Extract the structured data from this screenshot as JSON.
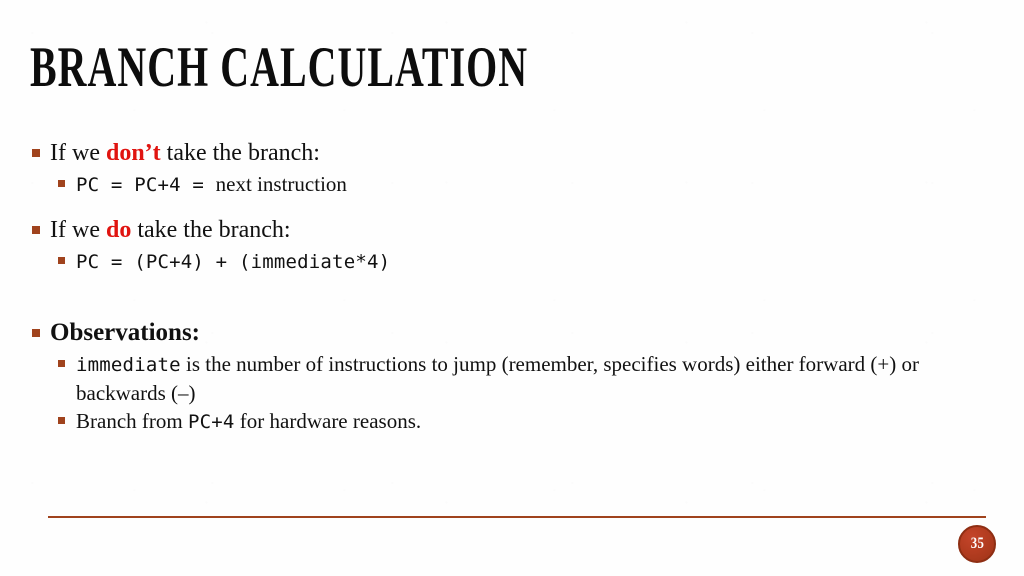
{
  "slide": {
    "title": "BRANCH CALCULATION",
    "page_number": "35",
    "accent_color": "#a0431d",
    "emphasis_color": "#e01410",
    "text_color": "#111111",
    "background_color": "#ffffff"
  },
  "content": {
    "group1": {
      "lead_a": "If we ",
      "lead_emph": "don’t",
      "lead_b": " take the branch:",
      "sub_code": "PC = PC+4 = ",
      "sub_text": "next instruction"
    },
    "group2": {
      "lead_a": "If we ",
      "lead_emph": "do",
      "lead_b": " take the branch:",
      "sub_code": "PC = (PC+4) + (immediate*4)"
    },
    "group3": {
      "heading": "Observations:",
      "item1_code": "immediate",
      "item1_text": " is the number of instructions to jump (remember, specifies words) either forward (+) or backwards (–)",
      "item2_pre": "Branch from ",
      "item2_code": "PC+4",
      "item2_post": " for hardware reasons."
    }
  }
}
